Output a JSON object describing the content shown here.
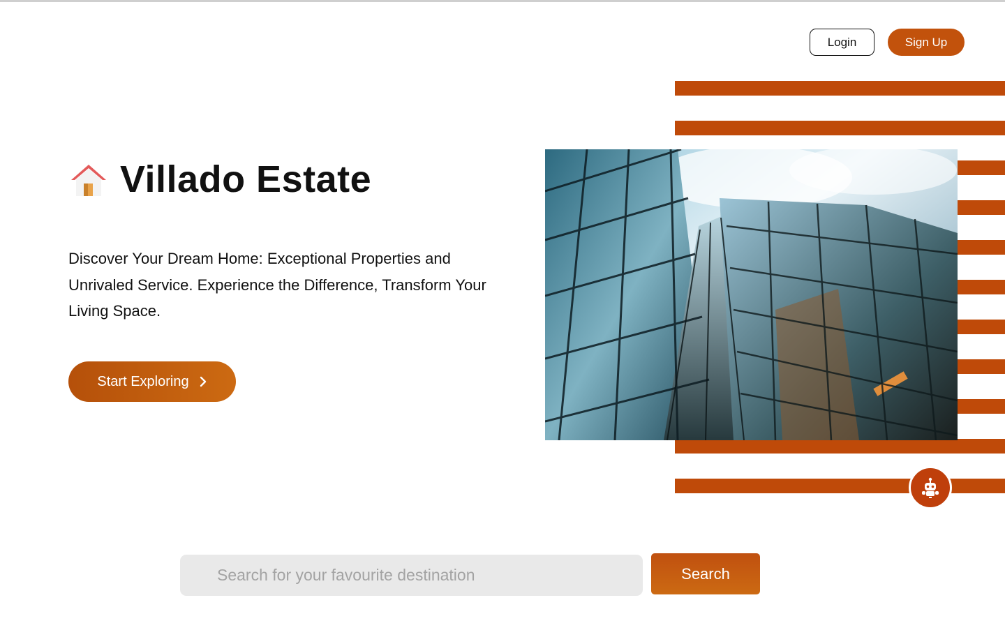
{
  "header": {
    "login_label": "Login",
    "signup_label": "Sign Up"
  },
  "hero": {
    "brand_title": "Villado Estate",
    "tagline": "Discover Your Dream Home: Exceptional Properties and Unrivaled Service. Experience the Difference, Transform Your Living Space.",
    "explore_label": "Start Exploring",
    "icon": "house-icon",
    "image": "glass-skyscraper-photo"
  },
  "search": {
    "placeholder": "Search for your favourite destination",
    "button_label": "Search"
  },
  "chatbot": {
    "icon": "robot-icon"
  },
  "colors": {
    "accent": "#c2520c",
    "stripe": "#bf4a09",
    "search_bg": "#e9e9e9"
  }
}
